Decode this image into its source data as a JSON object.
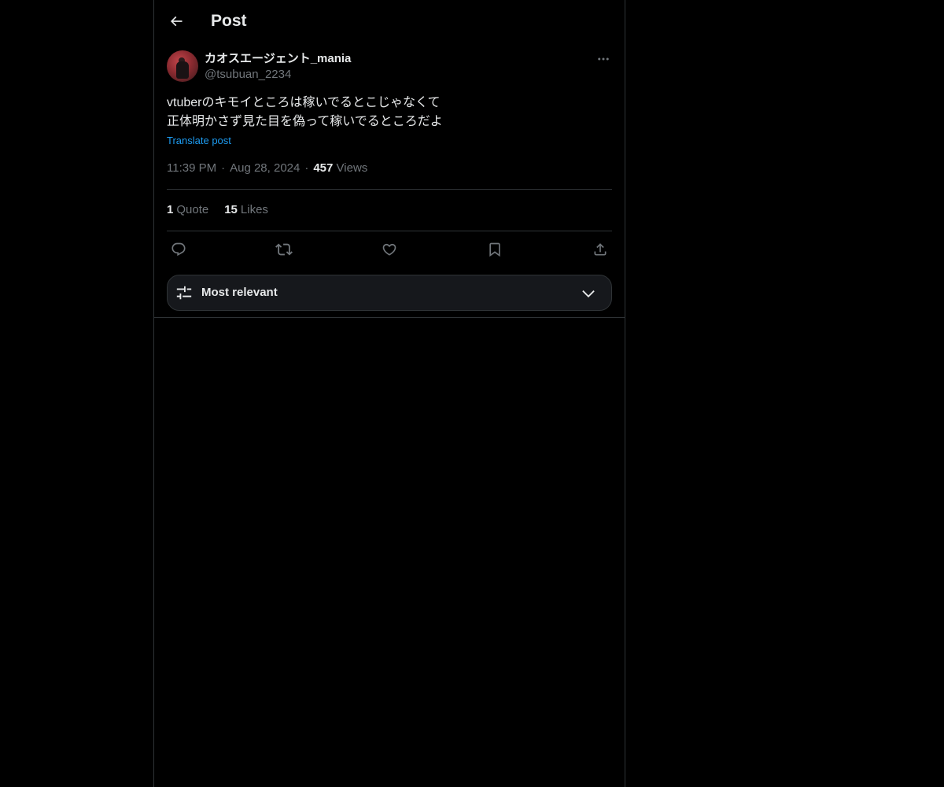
{
  "header": {
    "title": "Post",
    "back_icon": "arrow-left-icon"
  },
  "author": {
    "display_name": "カオスエージェント_mania",
    "handle": "@tsubuan_2234",
    "avatar_color": "#8a2a30"
  },
  "post": {
    "text": "vtuberのキモイところは稼いでるとこじゃなくて\n正体明かさず見た目を偽って稼いでるところだよ",
    "translate_label": "Translate post",
    "time": "11:39 PM",
    "date": "Aug 28, 2024",
    "views_count": "457",
    "views_label": "Views"
  },
  "stats": {
    "quote_count": "1",
    "quote_label": "Quote",
    "likes_count": "15",
    "likes_label": "Likes"
  },
  "actions": [
    {
      "name": "reply",
      "icon": "reply-icon"
    },
    {
      "name": "repost",
      "icon": "repost-icon"
    },
    {
      "name": "like",
      "icon": "heart-icon"
    },
    {
      "name": "bookmark",
      "icon": "bookmark-icon"
    },
    {
      "name": "share",
      "icon": "share-icon"
    }
  ],
  "sort": {
    "label": "Most relevant",
    "icon": "sliders-icon"
  },
  "colors": {
    "background": "#000000",
    "text": "#e7e9ea",
    "muted": "#71767b",
    "link": "#1d9bf0",
    "border": "#2f3336"
  }
}
